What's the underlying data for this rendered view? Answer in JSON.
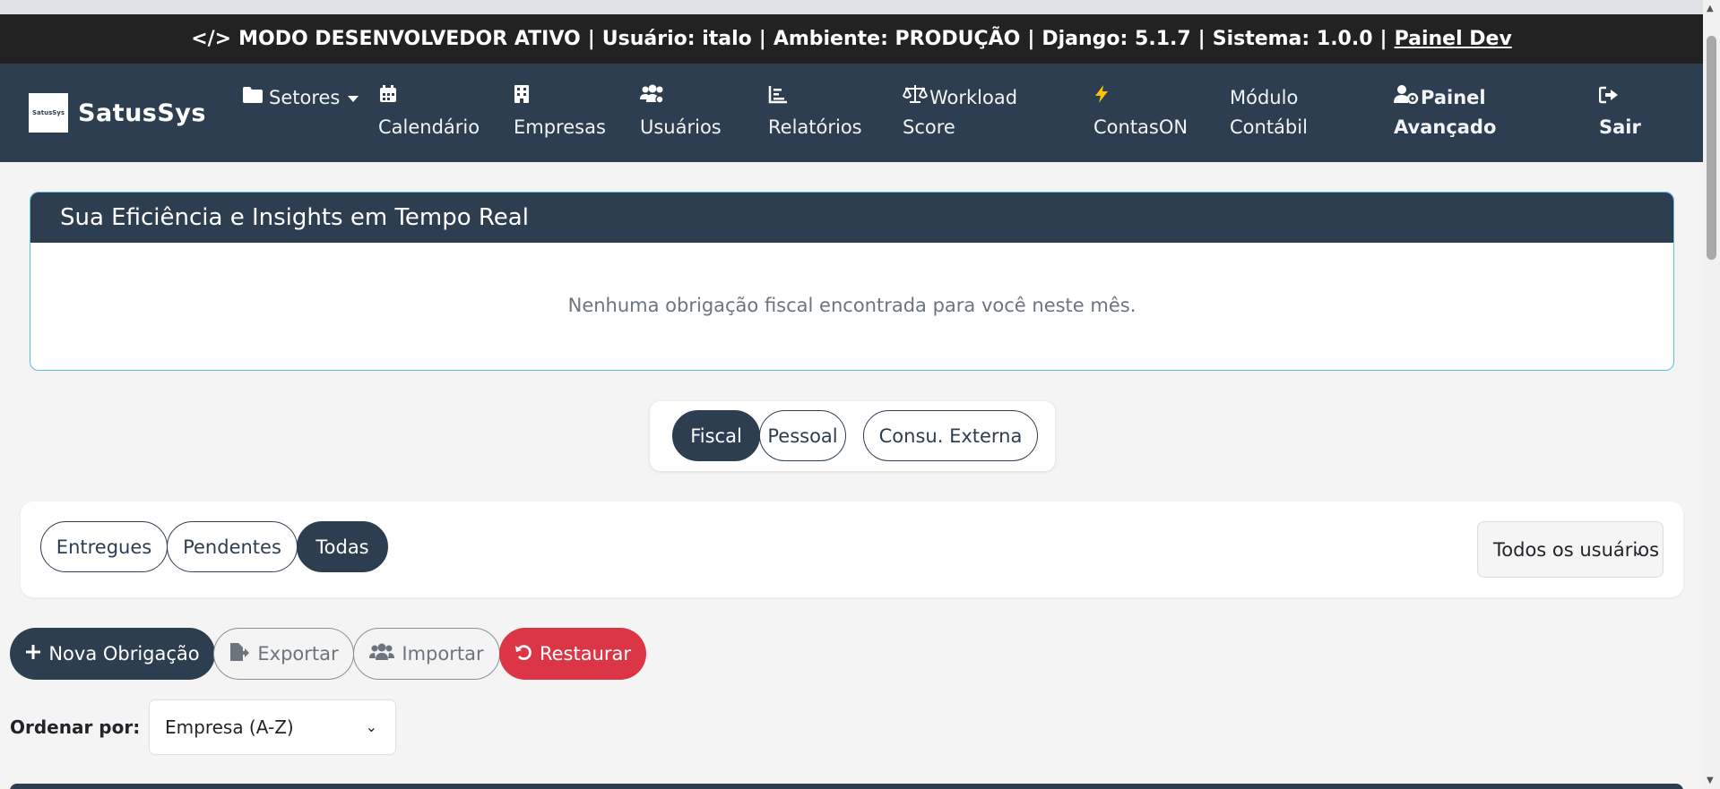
{
  "devbar": {
    "code_icon": "</>",
    "mode": "MODO DESENVOLVEDOR ATIVO",
    "user_label": "Usuário:",
    "user": "italo",
    "env_label": "Ambiente:",
    "env": "PRODUÇÃO",
    "django_label": "Django:",
    "django": "5.1.7",
    "system_label": "Sistema:",
    "system": "1.0.0",
    "sep": "|",
    "link": "Painel Dev"
  },
  "brand": {
    "logo_text": "SatusSys",
    "name": "SatusSys"
  },
  "nav": {
    "setores": "Setores",
    "calendario": "Calendário",
    "empresas": "Empresas",
    "usuarios": "Usuários",
    "relatorios": "Relatórios",
    "workload_1": "Workload",
    "workload_2": "Score",
    "contas": "ContasON",
    "modulo_1": "Módulo",
    "modulo_2": "Contábil",
    "painel_1": "Painel",
    "painel_2": "Avançado",
    "sair": "Sair"
  },
  "icons": {
    "folder": "folder-icon",
    "calendar": "calendar-icon",
    "building": "building-icon",
    "users": "users-icon",
    "chart": "chart-icon",
    "scale": "scale-icon",
    "bolt": "bolt-icon",
    "user_gear": "user-gear-icon",
    "sign_out": "sign-out-icon"
  },
  "insights": {
    "title": "Sua Eficiência e Insights em Tempo Real",
    "empty": "Nenhuma obrigação fiscal encontrada para você neste mês."
  },
  "tabs": {
    "fiscal": "Fiscal",
    "pessoal": "Pessoal",
    "externa": "Consu. Externa"
  },
  "filters": {
    "entregues": "Entregues",
    "pendentes": "Pendentes",
    "todas": "Todas",
    "user_select": "Todos os usuários"
  },
  "actions": {
    "nova": "Nova Obrigação",
    "exportar": "Exportar",
    "importar": "Importar",
    "restaurar": "Restaurar"
  },
  "sort": {
    "label": "Ordenar por:",
    "value": "Empresa (A-Z)"
  },
  "colors": {
    "primary": "#2c3e50",
    "danger": "#dc3545",
    "info_border": "#5bc0de"
  }
}
